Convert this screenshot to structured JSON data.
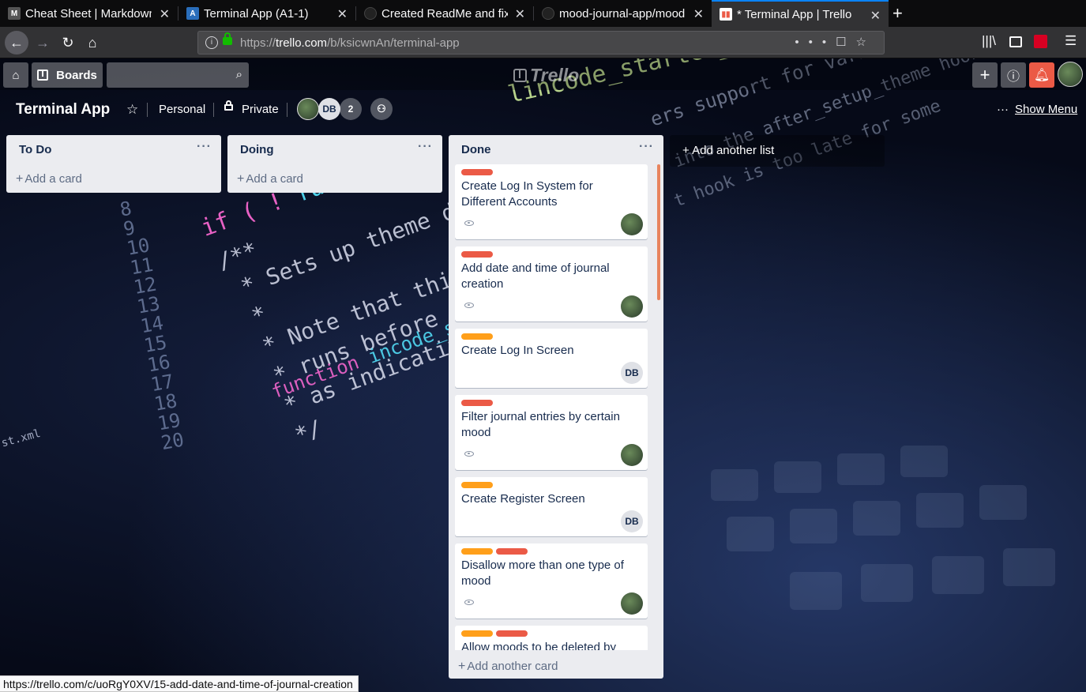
{
  "browser": {
    "tabs": [
      {
        "title": "Cheat Sheet | Markdown",
        "icon": "markdown-icon",
        "active": false
      },
      {
        "title": "Terminal App (A1-1)",
        "icon": "canvas-icon",
        "active": false
      },
      {
        "title": "Created ReadMe and fixe",
        "icon": "github-icon",
        "active": false
      },
      {
        "title": "mood-journal-app/mood",
        "icon": "github-icon",
        "active": false
      },
      {
        "title": "* Terminal App | Trello",
        "icon": "trello-icon",
        "active": true
      }
    ],
    "url_prefix": "https://",
    "url_host": "trello.com",
    "url_path": "/b/ksicwnAn/terminal-app",
    "status_url": "https://trello.com/c/uoRgY0XV/15-add-date-and-time-of-journal-creation"
  },
  "trello": {
    "boards_label": "Boards",
    "logo_text": "Trello",
    "search_placeholder": ""
  },
  "board": {
    "title": "Terminal App",
    "team": "Personal",
    "visibility": "Private",
    "member_initials": "DB",
    "member_count": "2",
    "show_menu": "Show Menu",
    "add_list": "+ Add another list"
  },
  "lists": [
    {
      "name": "To Do",
      "add_card": "Add a card"
    },
    {
      "name": "Doing",
      "add_card": "Add a card"
    },
    {
      "name": "Done",
      "add_card": "Add another card"
    }
  ],
  "done_cards": [
    {
      "title": "Create Log In System for Different Accounts",
      "labels": [
        "#eb5a46"
      ],
      "watched": true,
      "member": "photo"
    },
    {
      "title": "Add date and time of journal creation",
      "labels": [
        "#eb5a46"
      ],
      "watched": true,
      "member": "photo"
    },
    {
      "title": "Create Log In Screen",
      "labels": [
        "#ff9f1a"
      ],
      "watched": false,
      "member": "DB"
    },
    {
      "title": "Filter journal entries by certain mood",
      "labels": [
        "#eb5a46"
      ],
      "watched": true,
      "member": "photo"
    },
    {
      "title": "Create Register Screen",
      "labels": [
        "#ff9f1a"
      ],
      "watched": false,
      "member": "DB"
    },
    {
      "title": "Disallow more than one type of mood",
      "labels": [
        "#ff9f1a",
        "#eb5a46"
      ],
      "watched": true,
      "member": "photo"
    },
    {
      "title": "Allow moods to be deleted by",
      "labels": [
        "#ff9f1a",
        "#eb5a46"
      ],
      "watched": false,
      "member": ""
    }
  ],
  "colors": {
    "label_red": "#eb5a46",
    "label_orange": "#ff9f1a",
    "list_bg": "#ebecf0",
    "firefox_accent": "#0a84ff"
  }
}
